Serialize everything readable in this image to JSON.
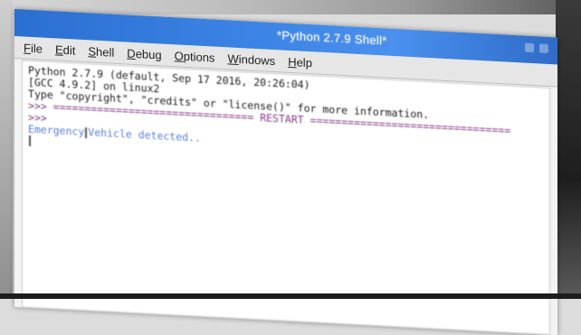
{
  "window": {
    "title": "*Python 2.7.9 Shell*"
  },
  "menu": {
    "items": [
      {
        "label": "File",
        "underline": "F",
        "rest": "ile"
      },
      {
        "label": "Edit",
        "underline": "E",
        "rest": "dit"
      },
      {
        "label": "Shell",
        "underline": "S",
        "rest": "hell"
      },
      {
        "label": "Debug",
        "underline": "D",
        "rest": "ebug"
      },
      {
        "label": "Options",
        "underline": "O",
        "rest": "ptions"
      },
      {
        "label": "Windows",
        "underline": "W",
        "rest": "indows"
      },
      {
        "label": "Help",
        "underline": "H",
        "rest": "elp"
      }
    ]
  },
  "shell": {
    "line1": "Python 2.7.9 (default, Sep 17 2016, 20:26:04)",
    "line2": "[GCC 4.9.2] on linux2",
    "line3": "Type \"copyright\", \"credits\" or \"license()\" for more information.",
    "prompt": ">>>",
    "restart": "================================ RESTART ================================",
    "output_before_cursor": "Emergency",
    "output_after_cursor": "Vehicle detected.."
  },
  "colors": {
    "titlebar": "#3c84e6",
    "prompt": "#7a3a7a",
    "output": "#5b7fd6"
  }
}
